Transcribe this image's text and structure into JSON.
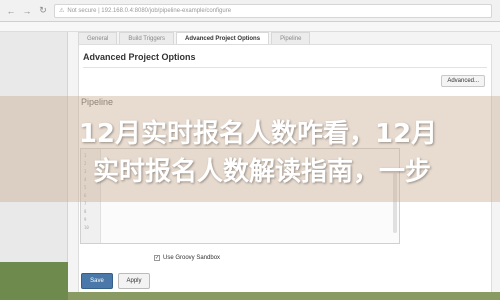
{
  "browser": {
    "back_icon": "back-arrow-icon",
    "forward_icon": "forward-arrow-icon",
    "url": "Not secure | 192.168.0.4:8080/job/pipeline-example/configure"
  },
  "tabs": [
    {
      "label": "General"
    },
    {
      "label": "Build Triggers"
    },
    {
      "label": "Advanced Project Options"
    },
    {
      "label": "Pipeline"
    }
  ],
  "advanced_project_options": {
    "title": "Advanced Project Options",
    "advanced_button": "Advanced..."
  },
  "pipeline": {
    "title": "Pipeline",
    "use_groovy_sandbox_label": "Use Groovy Sandbox",
    "use_groovy_sandbox_checked": true
  },
  "buttons": {
    "save": "Save",
    "apply": "Apply"
  },
  "overlay": {
    "line1": "12月实时报名人数咋看，12月",
    "line2": "实时报名人数解读指南，一步"
  }
}
